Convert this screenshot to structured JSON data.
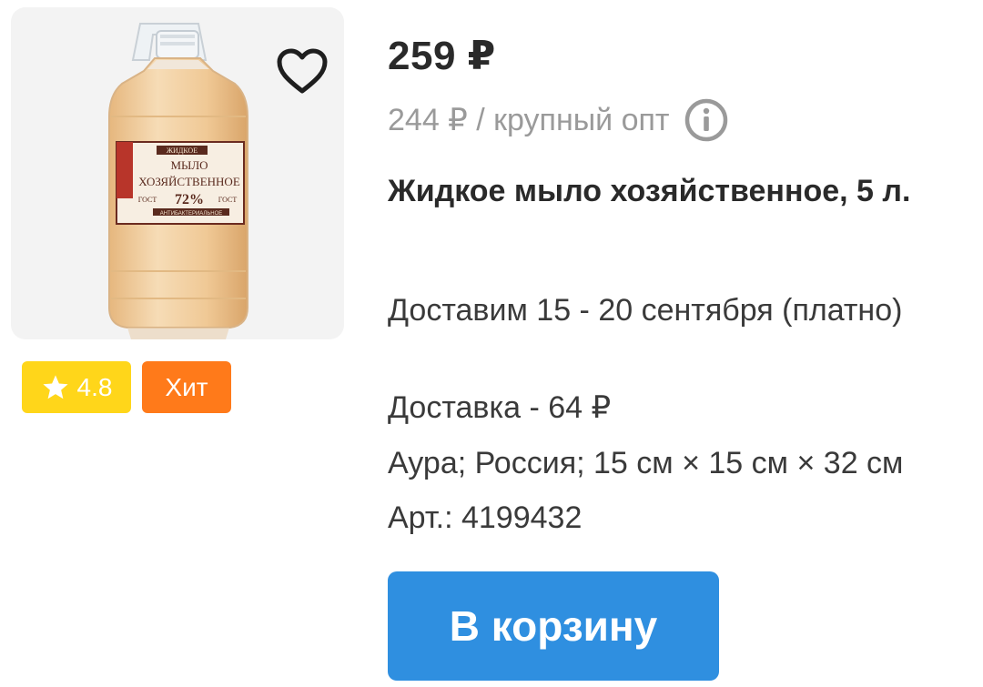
{
  "product": {
    "image_alt": "Жидкое мыло хозяйственное бутылка",
    "label_text": {
      "top": "ЖИДКОЕ",
      "line1": "МЫЛО",
      "line2": "ХОЗЯЙСТВЕННОЕ",
      "percent": "72%",
      "gost": "ГОСТ",
      "antibac": "АНТИБАКТЕРИАЛЬНОЕ"
    },
    "rating": "4.8",
    "hit_badge": "Хит",
    "price": "259 ₽",
    "wholesale_price": "244 ₽ / крупный опт",
    "title": "Жидкое мыло хозяйственное, 5 л.",
    "delivery_dates": "Доставим 15 - 20 сентября (платно)",
    "delivery_cost": "Доставка - 64 ₽",
    "specs": "Аура; Россия; 15 см × 15 см × 32 см",
    "article": "Арт.: 4199432",
    "cart_button": "В корзину"
  },
  "icons": {
    "favorite": "heart-outline-icon",
    "rating": "star-icon",
    "info": "info-icon"
  },
  "colors": {
    "rating_badge": "#ffd61a",
    "hit_badge": "#ff7a1a",
    "cart_button": "#2f8fe0",
    "muted_text": "#9a9a9a"
  }
}
